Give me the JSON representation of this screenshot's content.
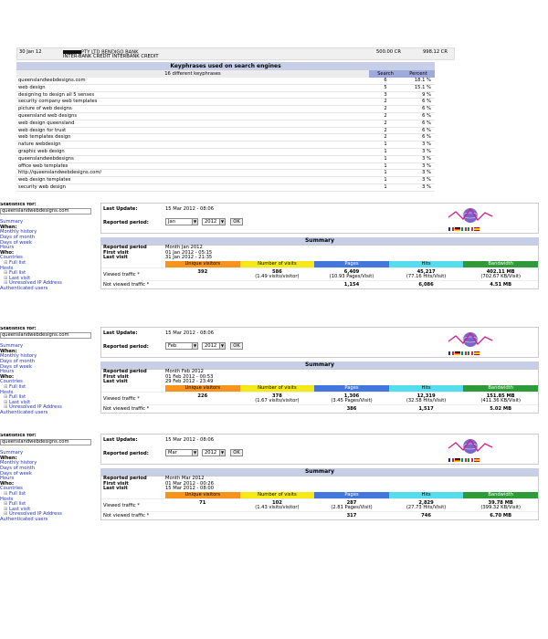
{
  "bank": {
    "date": "30 Jan 12",
    "line1": "PTY LTD BENDIGO BANK",
    "line2": "INTER-BANK CREDIT INTERBANK CREDIT",
    "amount": "500.00 CR",
    "balance": "998.12 CR"
  },
  "keyphrases": {
    "title": "Keyphrases used on search engines",
    "subtitle": "16 different keyphrases",
    "col_search": "Search",
    "col_percent": "Percent",
    "rows": [
      {
        "phrase": "queenslandwebdesigns.com",
        "count": "6",
        "percent": "18.1 %"
      },
      {
        "phrase": "web design",
        "count": "5",
        "percent": "15.1 %"
      },
      {
        "phrase": "designing to design all 5 senses",
        "count": "3",
        "percent": "9 %"
      },
      {
        "phrase": "security company web templates",
        "count": "2",
        "percent": "6 %"
      },
      {
        "phrase": "picture of web designs",
        "count": "2",
        "percent": "6 %"
      },
      {
        "phrase": "queensland web designs",
        "count": "2",
        "percent": "6 %"
      },
      {
        "phrase": "web design queensland",
        "count": "2",
        "percent": "6 %"
      },
      {
        "phrase": "web design for trust",
        "count": "2",
        "percent": "6 %"
      },
      {
        "phrase": "web templates design",
        "count": "2",
        "percent": "6 %"
      },
      {
        "phrase": "nature webdesign",
        "count": "1",
        "percent": "3 %"
      },
      {
        "phrase": "graphic web design",
        "count": "1",
        "percent": "3 %"
      },
      {
        "phrase": "queenslandwebdesigns",
        "count": "1",
        "percent": "3 %"
      },
      {
        "phrase": "office web templates",
        "count": "1",
        "percent": "3 %"
      },
      {
        "phrase": "http://queenslandwebdesigns.com/",
        "count": "1",
        "percent": "3 %"
      },
      {
        "phrase": "web design templates",
        "count": "1",
        "percent": "3 %"
      },
      {
        "phrase": "security web design",
        "count": "1",
        "percent": "3 %"
      }
    ]
  },
  "sidebar": {
    "stats_for": "Statistics for:",
    "site": "queenslandwebdesigns.com",
    "summary": "Summary",
    "when": "When:",
    "monthly_history": "Monthly history",
    "days_of_month": "Days of month",
    "days_of_week": "Days of week",
    "hours": "Hours",
    "who": "Who:",
    "countries": "Countries",
    "full_list": "Full list",
    "hosts": "Hosts",
    "last_visit": "Last visit",
    "unresolved_ip": "Unresolved IP Address",
    "authenticated_users": "Authenticated users"
  },
  "labels": {
    "last_update": "Last Update:",
    "reported_period": "Reported period:",
    "ok": "OK",
    "summary": "Summary",
    "reported_period_short": "Reported period",
    "first_visit": "First visit",
    "last_visit": "Last visit",
    "unique_visitors": "Unique visitors",
    "number_of_visits": "Number of visits",
    "pages": "Pages",
    "hits": "Hits",
    "bandwidth": "Bandwidth",
    "viewed_traffic": "Viewed traffic *",
    "not_viewed_traffic": "Not viewed traffic *"
  },
  "reports": [
    {
      "last_update": "15 Mar 2012 - 08:06",
      "month_sel": "Jan",
      "year_sel": "2012",
      "period": "Month Jan 2012",
      "first_visit": "01 Jan 2012 - 05:15",
      "last_visit": "31 Jan 2012 - 21:35",
      "uv": "392",
      "visits": "586",
      "visits_s": "(1.49 visits/visitor)",
      "pages": "6,409",
      "pages_s": "(10.93 Pages/Visit)",
      "hits": "45,217",
      "hits_s": "(77.16 Hits/Visit)",
      "bw": "402.11 MB",
      "bw_s": "(702.67 KB/Visit)",
      "nv_pages": "1,154",
      "nv_hits": "6,086",
      "nv_bw": "4.51 MB"
    },
    {
      "last_update": "15 Mar 2012 - 08:06",
      "month_sel": "Feb",
      "year_sel": "2012",
      "period": "Month Feb 2012",
      "first_visit": "01 Feb 2012 - 00:53",
      "last_visit": "29 Feb 2012 - 23:49",
      "uv": "226",
      "visits": "378",
      "visits_s": "(1.67 visits/visitor)",
      "pages": "1,306",
      "pages_s": "(3.45 Pages/Visit)",
      "hits": "12,319",
      "hits_s": "(32.58 Hits/Visit)",
      "bw": "151.85 MB",
      "bw_s": "(411.36 KB/Visit)",
      "nv_pages": "386",
      "nv_hits": "1,517",
      "nv_bw": "5.02 MB"
    },
    {
      "last_update": "15 Mar 2012 - 08:06",
      "month_sel": "Mar",
      "year_sel": "2012",
      "period": "Month Mar 2012",
      "first_visit": "01 Mar 2012 - 00:26",
      "last_visit": "15 Mar 2012 - 08:00",
      "uv": "71",
      "visits": "102",
      "visits_s": "(1.43 visits/visitor)",
      "pages": "287",
      "pages_s": "(2.81 Pages/Visit)",
      "hits": "2,829",
      "hits_s": "(27.73 Hits/Visit)",
      "bw": "39.78 MB",
      "bw_s": "(399.32 KB/Visit)",
      "nv_pages": "317",
      "nv_hits": "746",
      "nv_bw": "6.70 MB"
    }
  ],
  "colors": {
    "unique_visitors": "#f7941d",
    "visits": "#f5ea18",
    "pages": "#4477dd",
    "hits": "#55ddee",
    "bandwidth": "#2e9a3a"
  }
}
